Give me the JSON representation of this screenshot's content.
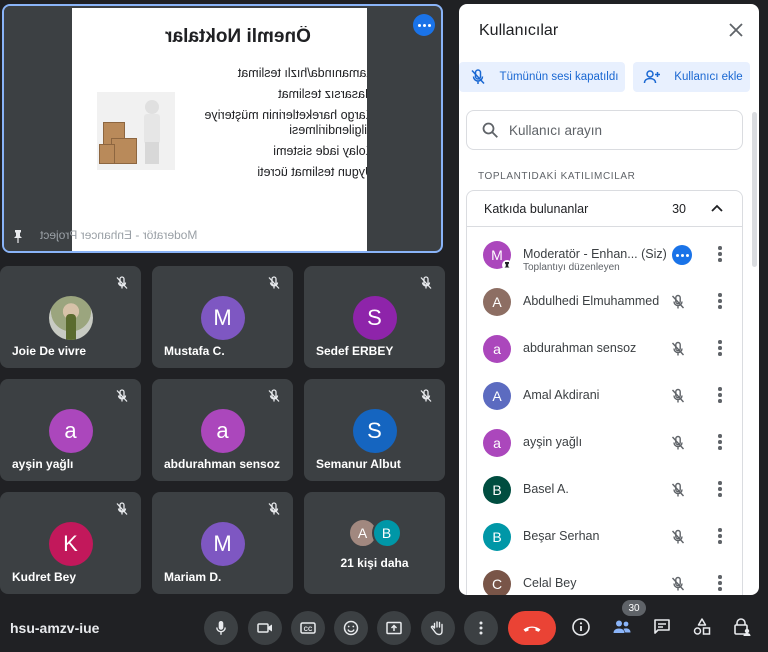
{
  "presentation": {
    "slide_title": "Önemli Noktalar",
    "bullets": [
      "Zamanında/hızlı teslimat",
      "Hasarsız teslimat",
      "Kargo hareketlerinin müşteriye bilgilendirilmesi",
      "Kolay iade sistemi",
      "Uygun teslimat ücreti"
    ],
    "presenter_label": "Moderatör - Enhancer Project"
  },
  "tiles": [
    {
      "name": "Joie De vivre",
      "initial": "",
      "color": ""
    },
    {
      "name": "Mustafa C.",
      "initial": "M",
      "color": "#7e57c2"
    },
    {
      "name": "Sedef ERBEY",
      "initial": "S",
      "color": "#8e24aa"
    },
    {
      "name": "ayşin yağlı",
      "initial": "a",
      "color": "#ab47bc"
    },
    {
      "name": "abdurahman sensoz",
      "initial": "a",
      "color": "#ab47bc"
    },
    {
      "name": "Semanur Albut",
      "initial": "S",
      "color": "#1565c0"
    },
    {
      "name": "Kudret Bey",
      "initial": "K",
      "color": "#c2185b"
    },
    {
      "name": "Mariam D.",
      "initial": "M",
      "color": "#7e57c2"
    }
  ],
  "more_tile": {
    "label": "21 kişi daha",
    "avatars": [
      {
        "initial": "A",
        "color": "#a1887f"
      },
      {
        "initial": "B",
        "color": "#0097a7"
      }
    ]
  },
  "panel": {
    "title": "Kullanıcılar",
    "mute_all_label": "Tümünün sesi kapatıldı",
    "add_user_label": "Kullanıcı ekle",
    "search_placeholder": "Kullanıcı arayın",
    "section_label": "TOPLANTIDAKİ KATILIMCILAR",
    "group_title": "Katkıda bulunanlar",
    "group_count": "30",
    "participants": [
      {
        "name": "Moderatör - Enhan...",
        "suffix": "(Siz)",
        "sub": "Toplantıyı düzenleyen",
        "initial": "M",
        "color": "#ab47bc"
      },
      {
        "name": "Abdulhedi Elmuhammed",
        "initial": "A",
        "color": "#8d6e63"
      },
      {
        "name": "abdurahman sensoz",
        "initial": "a",
        "color": "#ab47bc"
      },
      {
        "name": "Amal Akdirani",
        "initial": "A",
        "color": "#5c6bc0"
      },
      {
        "name": "ayşin yağlı",
        "initial": "a",
        "color": "#ab47bc"
      },
      {
        "name": "Basel A.",
        "initial": "B",
        "color": "#004d40"
      },
      {
        "name": "Beşar Serhan",
        "initial": "B",
        "color": "#0097a7"
      },
      {
        "name": "Celal Bey",
        "initial": "C",
        "color": "#795548"
      }
    ]
  },
  "bottom_bar": {
    "meeting_code": "hsu-amzv-iue",
    "participants_badge": "30"
  },
  "colors": {
    "accent": "#1a73e8",
    "end_call": "#ea4335",
    "background": "#202124",
    "tile": "#3c4043"
  }
}
